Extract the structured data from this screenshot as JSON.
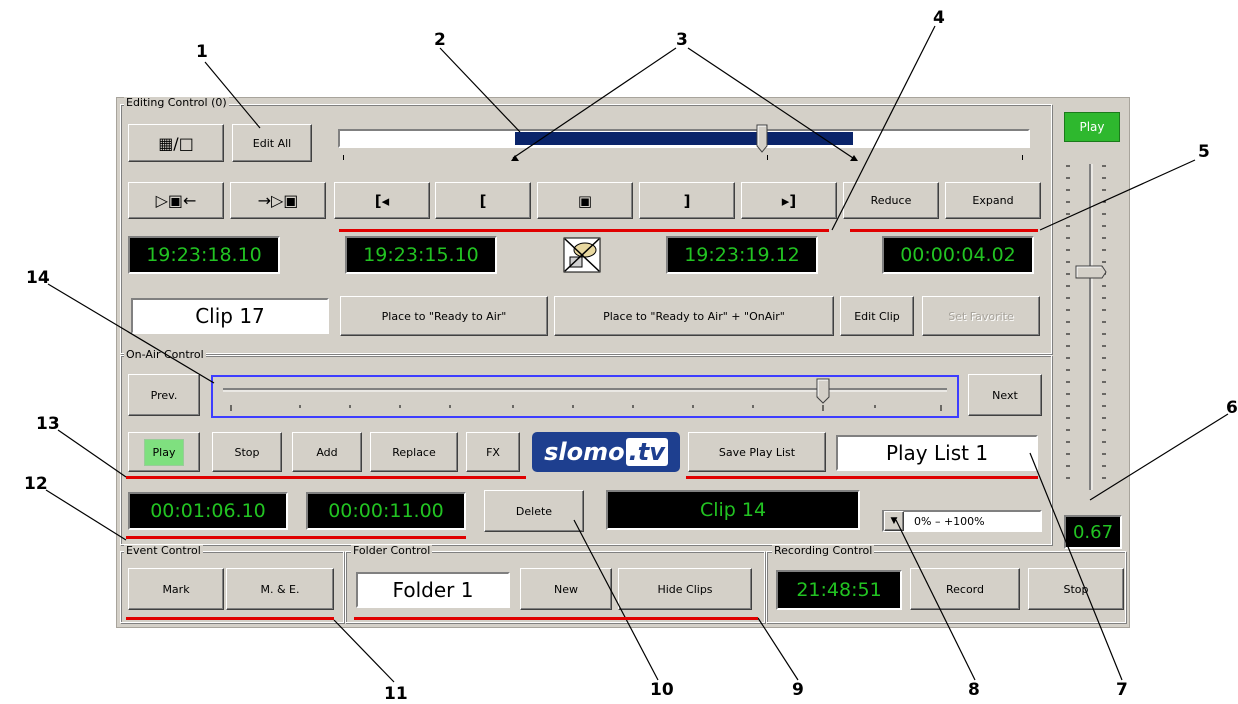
{
  "annotations": [
    "1",
    "2",
    "3",
    "4",
    "5",
    "6",
    "7",
    "8",
    "9",
    "10",
    "11",
    "12",
    "13",
    "14"
  ],
  "editing_control": {
    "title": "Editing Control (0)",
    "grid_btn": "▦/□",
    "edit_all": "Edit All",
    "btn_in_left": "▷▣←",
    "btn_out_right": "→▷▣",
    "btn_goto_in": "[◂",
    "btn_mark_in": "[",
    "btn_center": "▣",
    "btn_mark_out": "]",
    "btn_goto_out": "▸]",
    "reduce": "Reduce",
    "expand": "Expand",
    "tc_current": "19:23:18.10",
    "tc_in": "19:23:15.10",
    "tc_out": "19:23:19.12",
    "tc_duration": "00:00:04.02",
    "clip_name": "Clip 17",
    "place_ready": "Place to \"Ready to Air\"",
    "place_ready_onair": "Place to \"Ready to Air\" + \"OnAir\"",
    "edit_clip": "Edit Clip",
    "set_favorite": "Set Favorite"
  },
  "side": {
    "play": "Play",
    "speed_value": "0.67"
  },
  "on_air_control": {
    "title": "On-Air Control",
    "prev": "Prev.",
    "next": "Next",
    "play": "Play",
    "stop": "Stop",
    "add": "Add",
    "replace": "Replace",
    "fx": "FX",
    "logo_main": "slomo",
    "logo_suffix": ".tv",
    "save_playlist": "Save Play List",
    "playlist_name": "Play List 1",
    "tc_position": "00:01:06.10",
    "tc_remaining": "00:00:11.00",
    "delete": "Delete",
    "current_clip": "Clip 14",
    "speed_range": "0%  –  +100%"
  },
  "event_control": {
    "title": "Event Control",
    "mark": "Mark",
    "mark_e": "M. & E."
  },
  "folder_control": {
    "title": "Folder Control",
    "folder_name": "Folder 1",
    "new": "New",
    "hide_clips": "Hide Clips"
  },
  "recording_control": {
    "title": "Recording Control",
    "time": "21:48:51",
    "record": "Record",
    "stop": "Stop"
  },
  "colors": {
    "led_text": "#22c322",
    "selection": "#0a246a",
    "play_green": "#2eb82e",
    "annot_line": "#e00000",
    "logo_blue": "#1e3f8f"
  }
}
